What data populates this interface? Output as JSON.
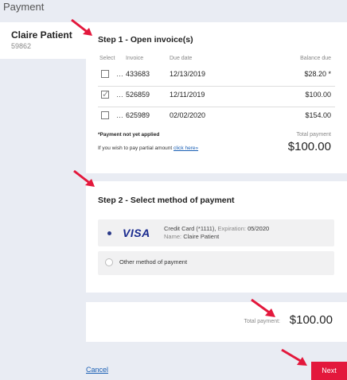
{
  "page": {
    "title": "Payment"
  },
  "patient": {
    "name": "Claire Patient",
    "id": "59862"
  },
  "step1": {
    "title": "Step 1 - Open invoice(s)",
    "columns": {
      "select": "Select",
      "invoice": "Invoice",
      "due_date": "Due date",
      "balance_due": "Balance due"
    },
    "rows": [
      {
        "ellipsis": "…",
        "invoice": "433683",
        "due_date": "12/13/2019",
        "balance": "$28.20 *",
        "checked": false
      },
      {
        "ellipsis": "…",
        "invoice": "526859",
        "due_date": "12/11/2019",
        "balance": "$100.00",
        "checked": true
      },
      {
        "ellipsis": "…",
        "invoice": "625989",
        "due_date": "02/02/2020",
        "balance": "$154.00",
        "checked": false
      }
    ],
    "note": "*Payment not yet applied",
    "partial_text": "If you wish to pay partial amount",
    "partial_link": "click here»",
    "total_label": "Total payment",
    "total_value": "$100.00"
  },
  "step2": {
    "title": "Step 2 - Select method of payment",
    "card": {
      "brand": "VISA",
      "type": "Credit Card (*1111),",
      "expiration_label": "Expiration:",
      "expiration_value": "05/2020",
      "name_label": "Name:",
      "name_value": "Claire Patient",
      "selected": true
    },
    "other": {
      "label": "Other method of payment",
      "selected": false
    }
  },
  "summary": {
    "total_label": "Total payment:",
    "total_value": "$100.00"
  },
  "footer": {
    "cancel_label": "Cancel",
    "next_label": "Next"
  },
  "colors": {
    "accent_red": "#e3183c",
    "visa_blue": "#1a2b8f",
    "link_blue": "#1a5fb4",
    "radio_selected": "#2a3a88"
  }
}
